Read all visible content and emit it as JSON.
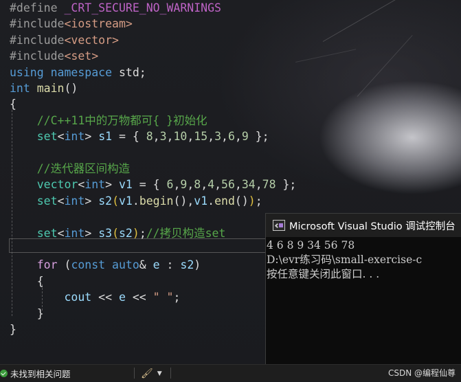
{
  "editor": {
    "lines": [
      {
        "tokens": [
          {
            "t": "#define ",
            "c": "k-dir"
          },
          {
            "t": "_CRT_SECURE_NO_WARNINGS",
            "c": "k-mac"
          }
        ]
      },
      {
        "tokens": [
          {
            "t": "#include",
            "c": "k-dir"
          },
          {
            "t": "<iostream>",
            "c": "k-str"
          }
        ]
      },
      {
        "tokens": [
          {
            "t": "#include",
            "c": "k-dir"
          },
          {
            "t": "<vector>",
            "c": "k-str"
          }
        ]
      },
      {
        "tokens": [
          {
            "t": "#include",
            "c": "k-dir"
          },
          {
            "t": "<set>",
            "c": "k-str"
          }
        ]
      },
      {
        "tokens": [
          {
            "t": "using",
            "c": "k-kw"
          },
          {
            "t": " ",
            "c": "k-pl"
          },
          {
            "t": "namespace",
            "c": "k-kw"
          },
          {
            "t": " std;",
            "c": "k-pl"
          }
        ]
      },
      {
        "tokens": [
          {
            "t": "int",
            "c": "k-kw"
          },
          {
            "t": " ",
            "c": "k-pl"
          },
          {
            "t": "main",
            "c": "k-fn"
          },
          {
            "t": "()",
            "c": "k-pl"
          }
        ]
      },
      {
        "tokens": [
          {
            "t": "{",
            "c": "k-pl"
          }
        ]
      },
      {
        "tokens": [
          {
            "t": "    ",
            "c": "k-pl"
          },
          {
            "t": "//C++11中的万物都可{ }初始化",
            "c": "k-com"
          }
        ]
      },
      {
        "tokens": [
          {
            "t": "    ",
            "c": "k-pl"
          },
          {
            "t": "set",
            "c": "k-ty"
          },
          {
            "t": "<",
            "c": "k-pl"
          },
          {
            "t": "int",
            "c": "k-kw"
          },
          {
            "t": "> ",
            "c": "k-pl"
          },
          {
            "t": "s1",
            "c": "k-var"
          },
          {
            "t": " = { ",
            "c": "k-pl"
          },
          {
            "t": "8",
            "c": "k-num"
          },
          {
            "t": ",",
            "c": "k-pl"
          },
          {
            "t": "3",
            "c": "k-num"
          },
          {
            "t": ",",
            "c": "k-pl"
          },
          {
            "t": "10",
            "c": "k-num"
          },
          {
            "t": ",",
            "c": "k-pl"
          },
          {
            "t": "15",
            "c": "k-num"
          },
          {
            "t": ",",
            "c": "k-pl"
          },
          {
            "t": "3",
            "c": "k-num"
          },
          {
            "t": ",",
            "c": "k-pl"
          },
          {
            "t": "6",
            "c": "k-num"
          },
          {
            "t": ",",
            "c": "k-pl"
          },
          {
            "t": "9",
            "c": "k-num"
          },
          {
            "t": " };",
            "c": "k-pl"
          }
        ]
      },
      {
        "tokens": []
      },
      {
        "tokens": [
          {
            "t": "    ",
            "c": "k-pl"
          },
          {
            "t": "//迭代器区间构造",
            "c": "k-com"
          }
        ]
      },
      {
        "tokens": [
          {
            "t": "    ",
            "c": "k-pl"
          },
          {
            "t": "vector",
            "c": "k-ty"
          },
          {
            "t": "<",
            "c": "k-pl"
          },
          {
            "t": "int",
            "c": "k-kw"
          },
          {
            "t": "> ",
            "c": "k-pl"
          },
          {
            "t": "v1",
            "c": "k-var"
          },
          {
            "t": " = { ",
            "c": "k-pl"
          },
          {
            "t": "6",
            "c": "k-num"
          },
          {
            "t": ",",
            "c": "k-pl"
          },
          {
            "t": "9",
            "c": "k-num"
          },
          {
            "t": ",",
            "c": "k-pl"
          },
          {
            "t": "8",
            "c": "k-num"
          },
          {
            "t": ",",
            "c": "k-pl"
          },
          {
            "t": "4",
            "c": "k-num"
          },
          {
            "t": ",",
            "c": "k-pl"
          },
          {
            "t": "56",
            "c": "k-num"
          },
          {
            "t": ",",
            "c": "k-pl"
          },
          {
            "t": "34",
            "c": "k-num"
          },
          {
            "t": ",",
            "c": "k-pl"
          },
          {
            "t": "78",
            "c": "k-num"
          },
          {
            "t": " };",
            "c": "k-pl"
          }
        ]
      },
      {
        "tokens": [
          {
            "t": "    ",
            "c": "k-pl"
          },
          {
            "t": "set",
            "c": "k-ty"
          },
          {
            "t": "<",
            "c": "k-pl"
          },
          {
            "t": "int",
            "c": "k-kw"
          },
          {
            "t": "> ",
            "c": "k-pl"
          },
          {
            "t": "s2",
            "c": "k-var"
          },
          {
            "t": "(",
            "c": "k-par"
          },
          {
            "t": "v1",
            "c": "k-var"
          },
          {
            "t": ".",
            "c": "k-pl"
          },
          {
            "t": "begin",
            "c": "k-fn"
          },
          {
            "t": "(),",
            "c": "k-pl"
          },
          {
            "t": "v1",
            "c": "k-var"
          },
          {
            "t": ".",
            "c": "k-pl"
          },
          {
            "t": "end",
            "c": "k-fn"
          },
          {
            "t": "()",
            "c": "k-pl"
          },
          {
            "t": ")",
            "c": "k-par"
          },
          {
            "t": ";",
            "c": "k-pl"
          }
        ]
      },
      {
        "tokens": []
      },
      {
        "tokens": [
          {
            "t": "    ",
            "c": "k-pl"
          },
          {
            "t": "set",
            "c": "k-ty"
          },
          {
            "t": "<",
            "c": "k-pl"
          },
          {
            "t": "int",
            "c": "k-kw"
          },
          {
            "t": "> ",
            "c": "k-pl"
          },
          {
            "t": "s3",
            "c": "k-var"
          },
          {
            "t": "(",
            "c": "k-par"
          },
          {
            "t": "s2",
            "c": "k-var"
          },
          {
            "t": ")",
            "c": "k-par"
          },
          {
            "t": ";",
            "c": "k-pl"
          },
          {
            "t": "//拷贝构造set",
            "c": "k-com"
          }
        ]
      },
      {
        "tokens": []
      },
      {
        "tokens": [
          {
            "t": "    ",
            "c": "k-pl"
          },
          {
            "t": "for",
            "c": "k-ctl"
          },
          {
            "t": " (",
            "c": "k-pl"
          },
          {
            "t": "const",
            "c": "k-kw"
          },
          {
            "t": " ",
            "c": "k-pl"
          },
          {
            "t": "auto",
            "c": "k-kw"
          },
          {
            "t": "& ",
            "c": "k-pl"
          },
          {
            "t": "e",
            "c": "k-var"
          },
          {
            "t": " : ",
            "c": "k-pl"
          },
          {
            "t": "s2",
            "c": "k-var"
          },
          {
            "t": ")",
            "c": "k-pl"
          }
        ]
      },
      {
        "tokens": [
          {
            "t": "    {",
            "c": "k-pl"
          }
        ]
      },
      {
        "tokens": [
          {
            "t": "        ",
            "c": "k-pl"
          },
          {
            "t": "cout",
            "c": "k-var"
          },
          {
            "t": " << ",
            "c": "k-pl"
          },
          {
            "t": "e",
            "c": "k-var"
          },
          {
            "t": " << ",
            "c": "k-pl"
          },
          {
            "t": "\" \"",
            "c": "k-str"
          },
          {
            "t": ";",
            "c": "k-pl"
          }
        ]
      },
      {
        "tokens": [
          {
            "t": "    }",
            "c": "k-pl"
          }
        ]
      },
      {
        "tokens": [
          {
            "t": "}",
            "c": "k-pl"
          }
        ]
      }
    ]
  },
  "console": {
    "title": "Microsoft Visual Studio 调试控制台",
    "lines": [
      "4 6 8 9 34 56 78",
      "D:\\evr练习码\\small-exercise-c",
      "按任意键关闭此窗口. . ."
    ]
  },
  "statusbar": {
    "issues_label": "未找到相关问题",
    "watermark": "CSDN @编程仙尊"
  },
  "icons": {
    "console_app": "vs-console-icon",
    "status_ok": "check-circle-icon",
    "cleanup": "brush-icon",
    "dropdown": "chevron-down-icon"
  }
}
